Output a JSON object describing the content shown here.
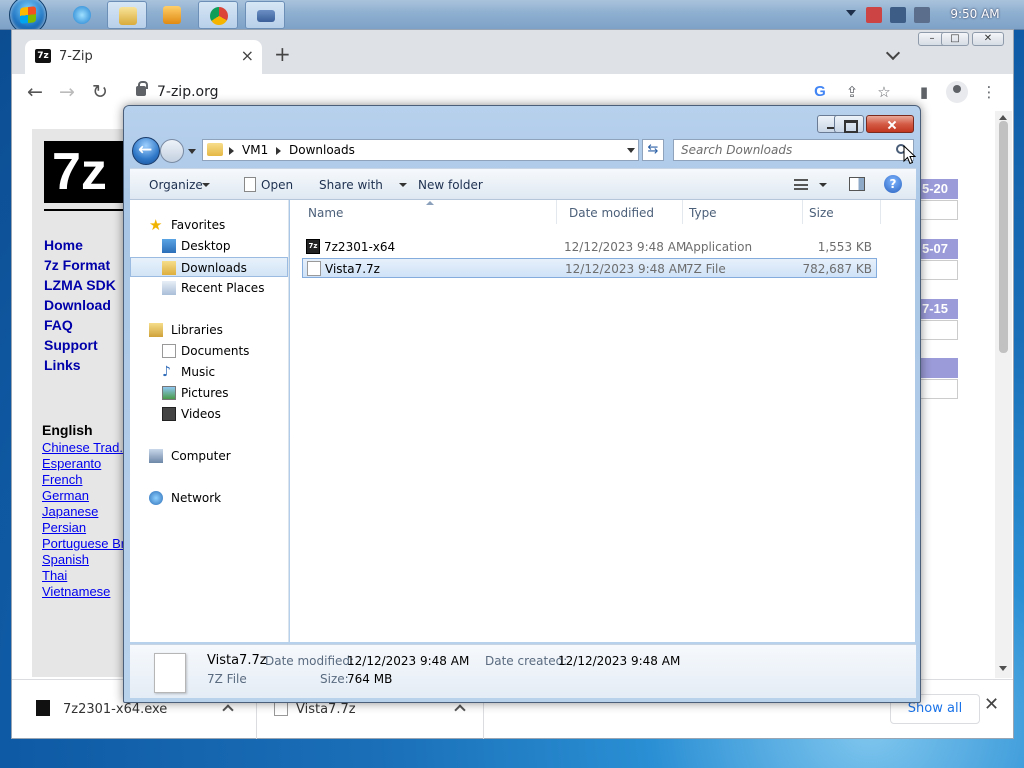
{
  "taskbar": {
    "clock": "9:50 AM",
    "apps": [
      "internet-explorer",
      "file-explorer",
      "media-player",
      "chrome",
      "keyboard"
    ]
  },
  "chrome": {
    "tab_title": "7-Zip",
    "favicon_text": "7z",
    "url": "7-zip.org"
  },
  "site": {
    "logo_text": "7z",
    "menu": [
      "Home",
      "7z Format",
      "LZMA SDK",
      "Download",
      "FAQ",
      "Support",
      "Links"
    ],
    "languages_title": "English",
    "languages": [
      "Chinese Trad.",
      "Esperanto",
      "French",
      "German",
      "Japanese",
      "Persian",
      "Portuguese Brazil",
      "Spanish",
      "Thai",
      "Vietnamese"
    ],
    "date_cells": [
      "5-20",
      "5-07",
      "7-15"
    ]
  },
  "downloads_bar": {
    "items": [
      {
        "name": "7z2301-x64.exe"
      },
      {
        "name": "Vista7.7z"
      }
    ],
    "show_all": "Show all"
  },
  "explorer": {
    "breadcrumb": [
      "VM1",
      "Downloads"
    ],
    "search_placeholder": "Search Downloads",
    "commands": {
      "organize": "Organize",
      "open": "Open",
      "share_with": "Share with",
      "new_folder": "New folder"
    },
    "nav": {
      "favorites": "Favorites",
      "desktop": "Desktop",
      "downloads": "Downloads",
      "recent_places": "Recent Places",
      "libraries": "Libraries",
      "documents": "Documents",
      "music": "Music",
      "pictures": "Pictures",
      "videos": "Videos",
      "computer": "Computer",
      "network": "Network"
    },
    "columns": {
      "name": "Name",
      "date_modified": "Date modified",
      "type": "Type",
      "size": "Size"
    },
    "files": [
      {
        "name": "7z2301-x64",
        "date": "12/12/2023 9:48 AM",
        "type": "Application",
        "size": "1,553 KB"
      },
      {
        "name": "Vista7.7z",
        "date": "12/12/2023 9:48 AM",
        "type": "7Z File",
        "size": "782,687 KB"
      }
    ],
    "details": {
      "name": "Vista7.7z",
      "type": "7Z File",
      "date_modified_label": "Date modified:",
      "date_modified": "12/12/2023 9:48 AM",
      "date_created_label": "Date created:",
      "date_created": "12/12/2023 9:48 AM",
      "size_label": "Size:",
      "size": "764 MB"
    }
  }
}
